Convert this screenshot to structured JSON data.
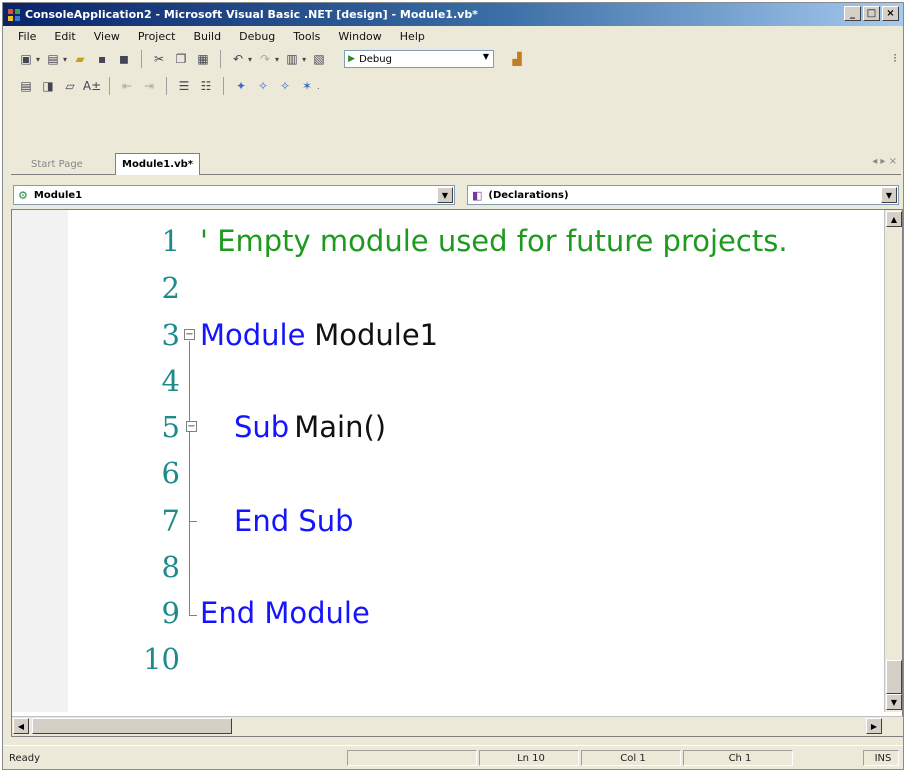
{
  "window": {
    "title": "ConsoleApplication2 - Microsoft Visual Basic .NET [design] - Module1.vb*",
    "buttons": {
      "minimize": "_",
      "maximize": "□",
      "close": "×"
    }
  },
  "menu": {
    "items": [
      "File",
      "Edit",
      "View",
      "Project",
      "Build",
      "Debug",
      "Tools",
      "Window",
      "Help"
    ]
  },
  "toolbar": {
    "config_value": "Debug"
  },
  "tabs": {
    "items": [
      {
        "label": "Start Page",
        "active": false
      },
      {
        "label": "Module1.vb*",
        "active": true
      }
    ],
    "controls": "◂ ▸ ×"
  },
  "navigation": {
    "class_combo": "Module1",
    "member_combo": "(Declarations)"
  },
  "editor": {
    "lines": [
      {
        "number": "1",
        "tokens": [
          {
            "text": "' Empty module used for future projects.",
            "type": "comment"
          }
        ]
      },
      {
        "number": "2",
        "tokens": []
      },
      {
        "number": "3",
        "tokens": [
          {
            "text": "Module",
            "type": "keyword"
          },
          {
            "text": " Module1",
            "type": "plain"
          }
        ]
      },
      {
        "number": "4",
        "tokens": []
      },
      {
        "number": "5",
        "tokens": [
          {
            "text": "Sub",
            "type": "keyword"
          },
          {
            "text": " Main()",
            "type": "plain"
          }
        ]
      },
      {
        "number": "6",
        "tokens": []
      },
      {
        "number": "7",
        "tokens": [
          {
            "text": "End Sub",
            "type": "keyword"
          }
        ]
      },
      {
        "number": "8",
        "tokens": []
      },
      {
        "number": "9",
        "tokens": [
          {
            "text": "End Module",
            "type": "keyword"
          }
        ]
      },
      {
        "number": "10",
        "tokens": []
      }
    ],
    "colors": {
      "keyword": "#1414ff",
      "comment": "#1e9a1e",
      "plain": "#111111",
      "line_number": "#1e8a8a"
    }
  },
  "statusbar": {
    "status": "Ready",
    "ln": "Ln 10",
    "col": "Col 1",
    "ch": "Ch 1",
    "ins": "INS"
  }
}
